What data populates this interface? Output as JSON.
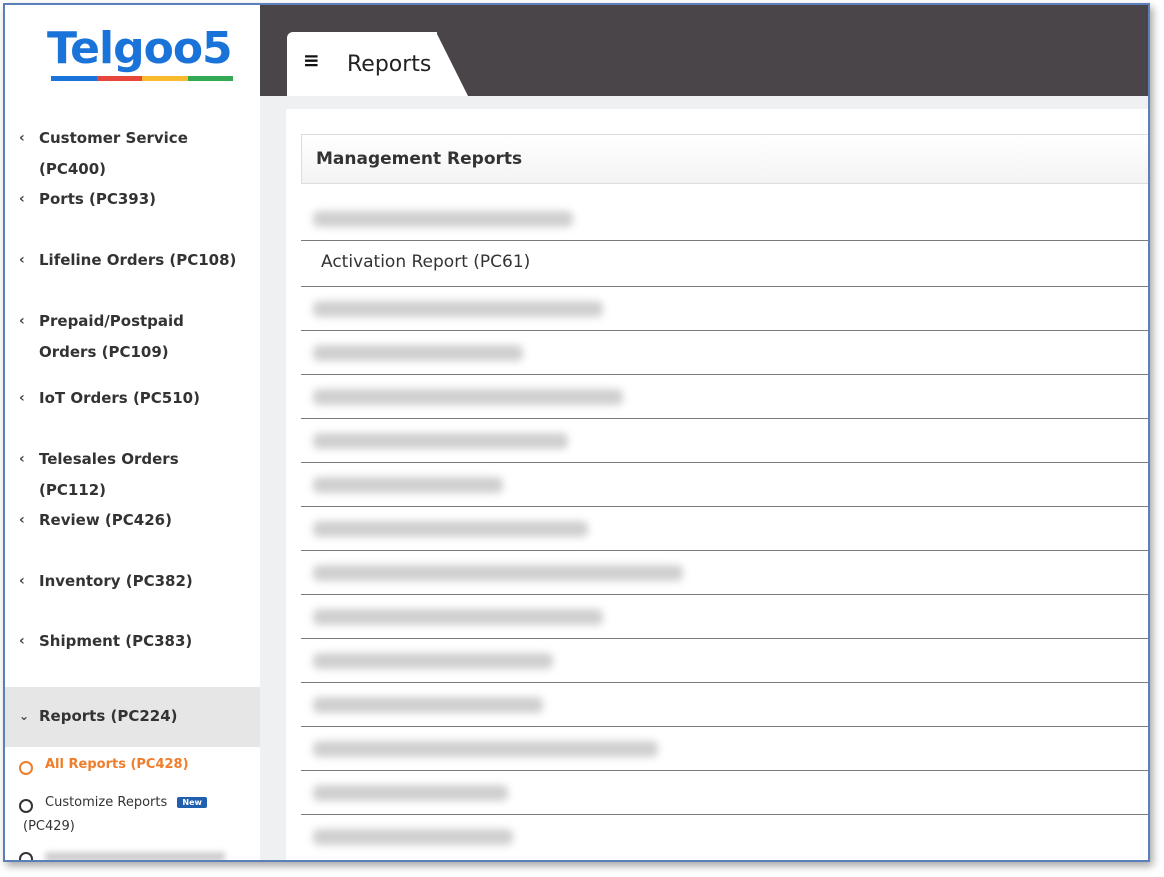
{
  "brand": {
    "logo_text": "Telgoo5",
    "logo_colors": [
      "#1a73d9",
      "#e8453c",
      "#f9bb2d",
      "#34a853"
    ]
  },
  "header": {
    "tab_title": "Reports"
  },
  "sidebar": {
    "items": [
      {
        "label": "Customer Service (PC400)"
      },
      {
        "label": "Ports (PC393)"
      },
      {
        "label": "Lifeline Orders (PC108)"
      },
      {
        "label": "Prepaid/Postpaid Orders (PC109)"
      },
      {
        "label": "IoT Orders (PC510)"
      },
      {
        "label": "Telesales Orders (PC112)"
      },
      {
        "label": "Review (PC426)"
      },
      {
        "label": "Inventory (PC382)"
      },
      {
        "label": "Shipment (PC383)"
      },
      {
        "label": "Reports (PC224)"
      }
    ],
    "subitems": [
      {
        "label": "All Reports (PC428)"
      },
      {
        "label": "Customize Reports",
        "label2": "(PC429)",
        "badge": "New"
      }
    ]
  },
  "panel": {
    "title": "Management Reports",
    "visible_row": "Activation Report (PC61)"
  },
  "colors": {
    "header_bg": "#4a4549",
    "active_sub": "#f07d2a",
    "badge_bg": "#1f5fae"
  }
}
